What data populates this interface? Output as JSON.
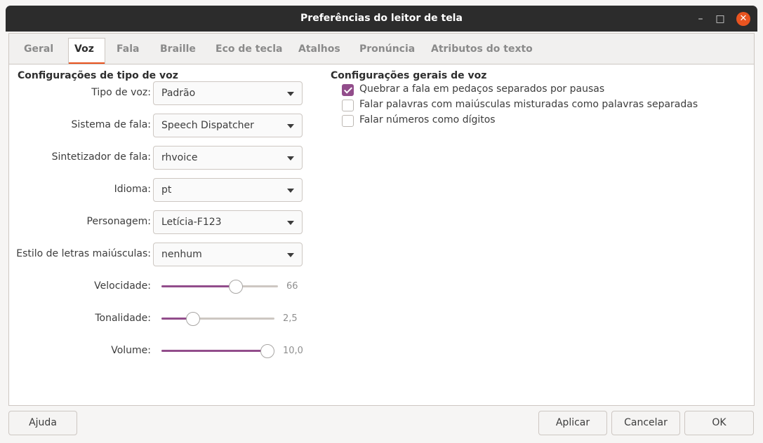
{
  "window": {
    "title": "Preferências do leitor de tela",
    "minimize_glyph": "–",
    "maximize_glyph": "□",
    "close_glyph": "✕"
  },
  "tabs": [
    "Geral",
    "Voz",
    "Fala",
    "Braille",
    "Eco de tecla",
    "Atalhos",
    "Pronúncia",
    "Atributos do texto"
  ],
  "active_tab": "Voz",
  "voice_type": {
    "section_title": "Configurações de tipo de voz",
    "fields": [
      {
        "label": "Tipo de voz:",
        "value": "Padrão"
      },
      {
        "label": "Sistema de fala:",
        "value": "Speech Dispatcher"
      },
      {
        "label": "Sintetizador de fala:",
        "value": "rhvoice"
      },
      {
        "label": "Idioma:",
        "value": "pt"
      },
      {
        "label": "Personagem:",
        "value": "Letícia-F123"
      },
      {
        "label": "Estilo de letras maiúsculas:",
        "value": "nenhum"
      }
    ],
    "sliders": [
      {
        "label": "Velocidade:",
        "value": "66",
        "fraction": 0.66
      },
      {
        "label": "Tonalidade:",
        "value": "2,5",
        "fraction": 0.25
      },
      {
        "label": "Volume:",
        "value": "10,0",
        "fraction": 1.0
      }
    ]
  },
  "general": {
    "section_title": "Configurações gerais de voz",
    "options": [
      {
        "label": "Quebrar a fala em pedaços separados por pausas",
        "checked": true
      },
      {
        "label": "Falar palavras com maiúsculas misturadas como palavras separadas",
        "checked": false
      },
      {
        "label": "Falar números como dígitos",
        "checked": false
      }
    ]
  },
  "buttons": {
    "help": "Ajuda",
    "apply": "Aplicar",
    "cancel": "Cancelar",
    "ok": "OK"
  },
  "colors": {
    "accent": "#e95420",
    "slider_fill": "#924d8b",
    "titlebar": "#2c2c2c"
  }
}
